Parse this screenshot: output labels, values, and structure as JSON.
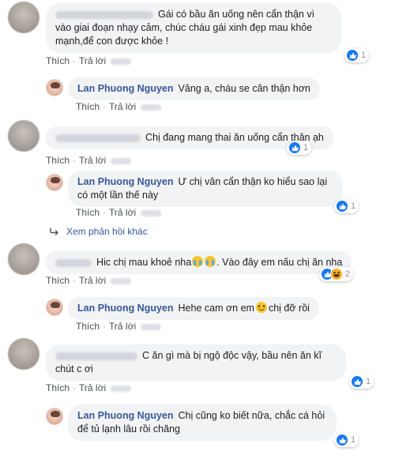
{
  "actions": {
    "like": "Thích",
    "reply": "Trả lời",
    "separator": "·"
  },
  "comments": [
    {
      "author": "",
      "text": "Gái có bầu ăn uống nên cẩn thận vì vào giai đoạn nhạy cảm, chúc cháu gái xinh đẹp mau khỏe mạnh,để con được khỏe !",
      "reactions": "1"
    },
    {
      "author": "Lan Phuong Nguyen",
      "text": "Vâng a, cháu se cân thận hơn"
    },
    {
      "author": "",
      "text": "Chị đang mang thai ăn uống cẩn thận ạh",
      "reactions": "1"
    },
    {
      "author": "Lan Phuong Nguyen",
      "text": "Ư chị vân cẩn thận ko hiểu sao lại có một lần thế này",
      "reactions": "1"
    },
    {
      "author": "",
      "text_before": "Hic chị mau khoẻ nha",
      "text_after": ". Vào đây em nấu chị ăn nha",
      "reactions": "2"
    },
    {
      "author": "Lan Phuong Nguyen",
      "text_before": "Hehe cam ơn em",
      "text_after": "chị đỡ rồi"
    },
    {
      "author": "",
      "text": "C ăn gì mà bị ngộ độc vậy, bầu nên ăn kĩ chút c ơi",
      "reactions": "1"
    },
    {
      "author": "Lan Phuong Nguyen",
      "text": "Chị cũng ko biết nữa, chắc cá hỏi để tủ lạnh lâu rồi chăng",
      "reactions": "1"
    }
  ],
  "more_replies": "Xem phản hồi khác",
  "icons": {
    "like": "like-icon",
    "haha": "haha-icon",
    "cry": "crying-emoji",
    "smile": "smile-emoji",
    "reply_arrow": "reply-arrow-icon"
  },
  "colors": {
    "author": "#385898",
    "bubble": "#f2f3f5",
    "like": "#1877f2"
  }
}
